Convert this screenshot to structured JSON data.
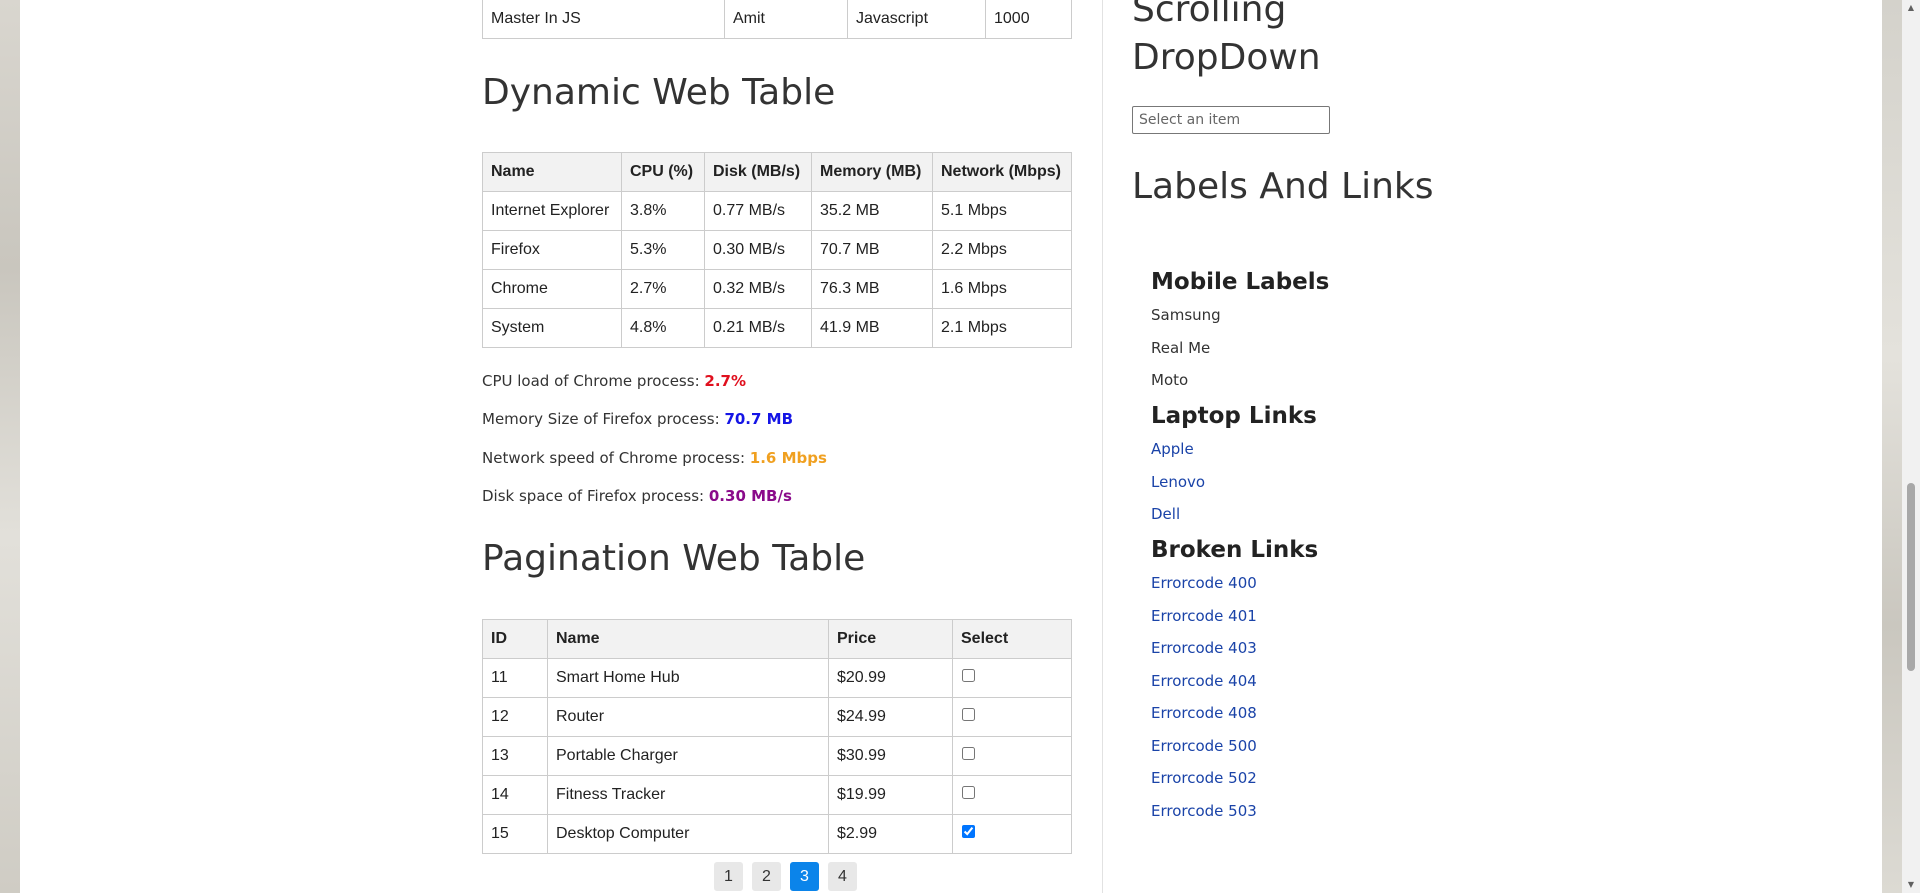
{
  "top_table": {
    "row": [
      "Master In JS",
      "Amit",
      "Javascript",
      "1000"
    ]
  },
  "dynamic": {
    "title": "Dynamic Web Table",
    "headers": [
      "Name",
      "CPU (%)",
      "Disk (MB/s)",
      "Memory (MB)",
      "Network (Mbps)"
    ],
    "rows": [
      [
        "Internet Explorer",
        "3.8%",
        "0.77 MB/s",
        "35.2 MB",
        "5.1 Mbps"
      ],
      [
        "Firefox",
        "5.3%",
        "0.30 MB/s",
        "70.7 MB",
        "2.2 Mbps"
      ],
      [
        "Chrome",
        "2.7%",
        "0.32 MB/s",
        "76.3 MB",
        "1.6 Mbps"
      ],
      [
        "System",
        "4.8%",
        "0.21 MB/s",
        "41.9 MB",
        "2.1 Mbps"
      ]
    ],
    "info": [
      {
        "label": "CPU load of Chrome process: ",
        "value": "2.7%",
        "color": "#e0101e"
      },
      {
        "label": "Memory Size of Firefox process: ",
        "value": "70.7 MB",
        "color": "#1515e6"
      },
      {
        "label": "Network speed of Chrome process: ",
        "value": "1.6 Mbps",
        "color": "#f0a020"
      },
      {
        "label": "Disk space of Firefox process: ",
        "value": "0.30 MB/s",
        "color": "#8a0a8a"
      }
    ]
  },
  "pagination": {
    "title": "Pagination Web Table",
    "headers": [
      "ID",
      "Name",
      "Price",
      "Select"
    ],
    "rows": [
      {
        "id": "11",
        "name": "Smart Home Hub",
        "price": "$20.99",
        "checked": false
      },
      {
        "id": "12",
        "name": "Router",
        "price": "$24.99",
        "checked": false
      },
      {
        "id": "13",
        "name": "Portable Charger",
        "price": "$30.99",
        "checked": false
      },
      {
        "id": "14",
        "name": "Fitness Tracker",
        "price": "$19.99",
        "checked": false
      },
      {
        "id": "15",
        "name": "Desktop Computer",
        "price": "$2.99",
        "checked": true
      }
    ],
    "pages": [
      "1",
      "2",
      "3",
      "4"
    ],
    "active_page": "3"
  },
  "sidebar": {
    "scrolling_title_1": "Scrolling",
    "scrolling_title_2": "DropDown",
    "dropdown_placeholder": "Select an item",
    "labels_links_title": "Labels And Links",
    "mobile_heading": "Mobile Labels",
    "mobile_labels": [
      "Samsung",
      "Real Me",
      "Moto"
    ],
    "laptop_heading": "Laptop Links",
    "laptop_links": [
      "Apple",
      "Lenovo",
      "Dell"
    ],
    "broken_heading": "Broken Links",
    "broken_links": [
      "Errorcode 400",
      "Errorcode 401",
      "Errorcode 403",
      "Errorcode 404",
      "Errorcode 408",
      "Errorcode 500",
      "Errorcode 502",
      "Errorcode 503"
    ]
  },
  "colors": {
    "link": "#1a43a8",
    "active_page": "#0b84ea"
  }
}
